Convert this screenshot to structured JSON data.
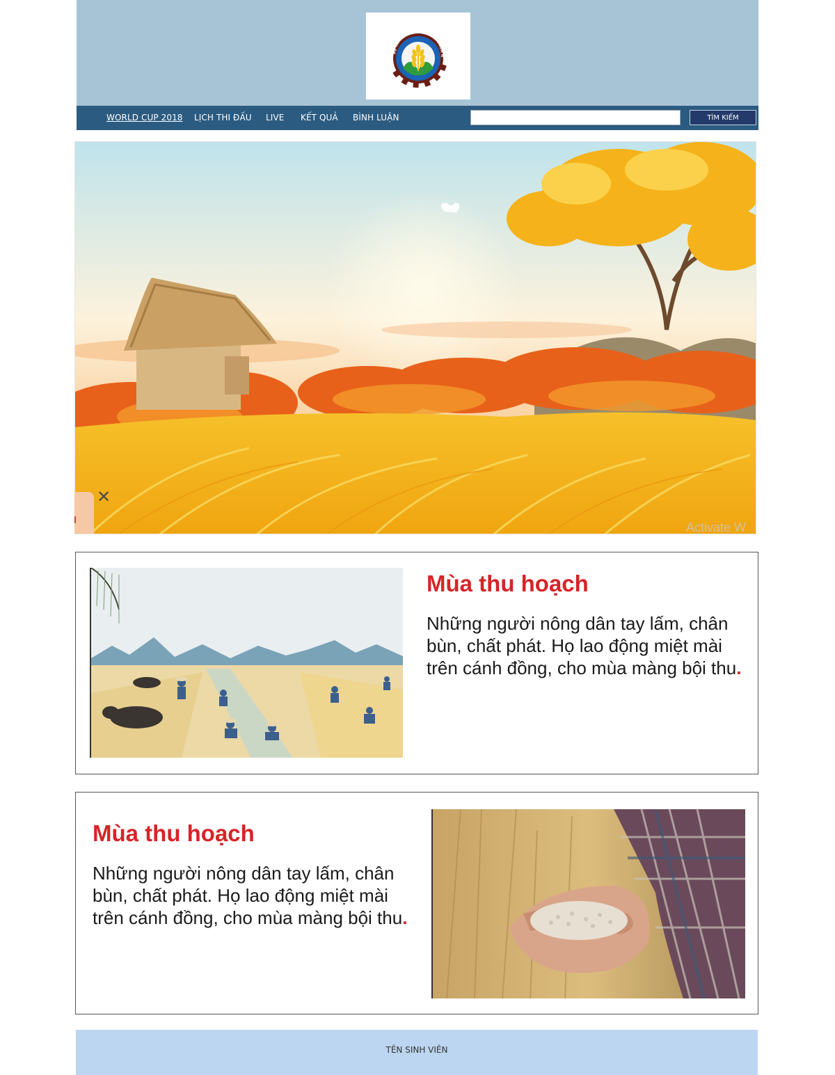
{
  "header": {
    "logo_alt": "Bộ Nông nghiệp và Phát triển Nông thôn logo",
    "logo_text": "BỘ NÔNG NGHIỆP VÀ PHÁT TRIỂN NÔNG THÔN"
  },
  "nav": {
    "items": [
      {
        "label": "WORLD CUP 2018",
        "active": true
      },
      {
        "label": "LỊCH THI ĐẤU"
      },
      {
        "label": "LIVE"
      },
      {
        "label": "KẾT QUẢ"
      },
      {
        "label": "BÌNH LUẬN"
      }
    ],
    "search": {
      "value": "",
      "placeholder": "",
      "button_label": "TÌM KIẾM"
    }
  },
  "hero": {
    "watermark": "Activate W",
    "close_symbol": "✕"
  },
  "cards": [
    {
      "title": "Mùa thu hoạch",
      "text": "Những người nông dân tay lấm, chân bùn, chất phát. Họ lao động miệt mài trên cánh đồng, cho mùa màng bội thu",
      "end_mark": "."
    },
    {
      "title": "Mùa thu hoạch",
      "text": "Những người nông dân tay lấm, chân bùn, chất phát. Họ lao động miệt mài trên cánh đồng, cho mùa màng bội thu",
      "end_mark": "."
    }
  ],
  "footer": {
    "text": "TÊN SINH VIÊN"
  },
  "colors": {
    "header_bg": "#a7c4d6",
    "nav_bg": "#2b5b81",
    "search_button_bg": "#233a6b",
    "title_red": "#d62428",
    "footer_bg": "#bcd5f0"
  }
}
